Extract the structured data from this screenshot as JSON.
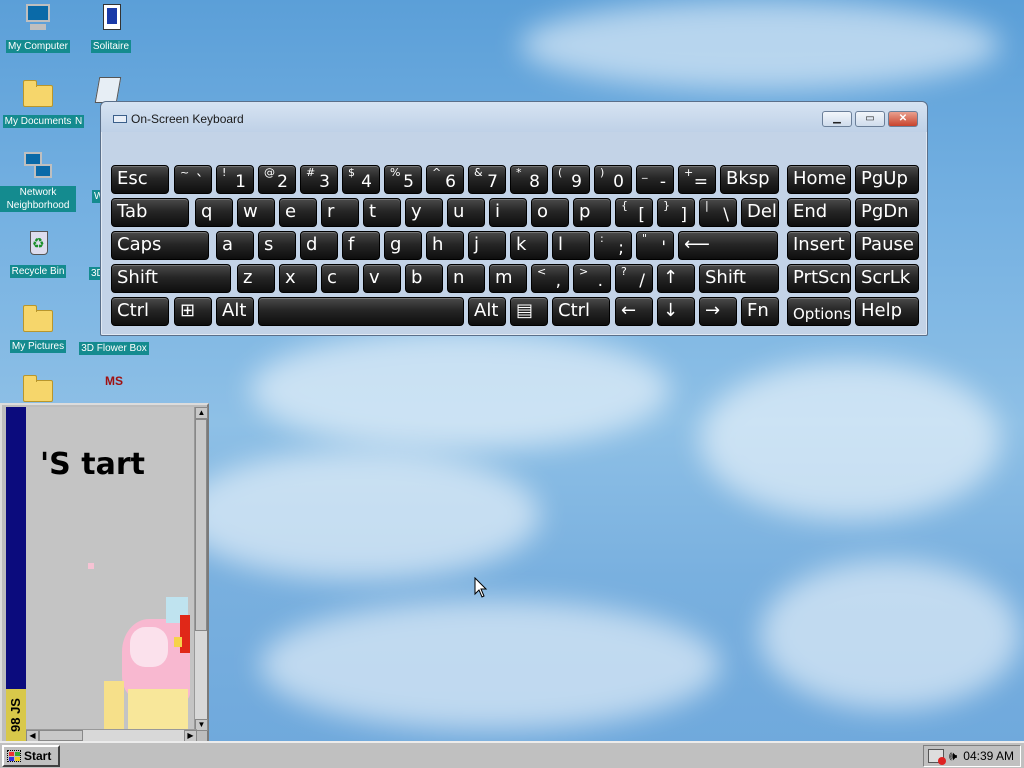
{
  "desktop": {
    "icons": [
      {
        "label": "My Computer"
      },
      {
        "label": "Solitaire"
      },
      {
        "label": "My Documents"
      },
      {
        "label": "N"
      },
      {
        "label": "Network Neighborhood"
      },
      {
        "label": "W"
      },
      {
        "label": "Recycle Bin"
      },
      {
        "label": "3D"
      },
      {
        "label": "My Pictures"
      },
      {
        "label": "3D Flower Box"
      }
    ],
    "extra_icon_text": "MS"
  },
  "osk": {
    "title": "On-Screen Keyboard",
    "controls": {
      "minimize": "▁",
      "restore": "▭",
      "close": "✕"
    },
    "rows": [
      [
        {
          "main": "Esc"
        },
        {
          "shift": "~",
          "base": "`"
        },
        {
          "shift": "!",
          "base": "1"
        },
        {
          "shift": "@",
          "base": "2"
        },
        {
          "shift": "#",
          "base": "3"
        },
        {
          "shift": "$",
          "base": "4"
        },
        {
          "shift": "%",
          "base": "5"
        },
        {
          "shift": "^",
          "base": "6"
        },
        {
          "shift": "&",
          "base": "7"
        },
        {
          "shift": "*",
          "base": "8"
        },
        {
          "shift": "(",
          "base": "9"
        },
        {
          "shift": ")",
          "base": "0"
        },
        {
          "shift": "_",
          "base": "-"
        },
        {
          "shift": "+",
          "base": "="
        },
        {
          "main": "Bksp"
        },
        {
          "main": "Home"
        },
        {
          "main": "PgUp"
        }
      ],
      [
        {
          "main": "Tab"
        },
        {
          "main": "q"
        },
        {
          "main": "w"
        },
        {
          "main": "e"
        },
        {
          "main": "r"
        },
        {
          "main": "t"
        },
        {
          "main": "y"
        },
        {
          "main": "u"
        },
        {
          "main": "i"
        },
        {
          "main": "o"
        },
        {
          "main": "p"
        },
        {
          "shift": "{",
          "base": "["
        },
        {
          "shift": "}",
          "base": "]"
        },
        {
          "shift": "|",
          "base": "\\"
        },
        {
          "main": "Del"
        },
        {
          "main": "End"
        },
        {
          "main": "PgDn"
        }
      ],
      [
        {
          "main": "Caps"
        },
        {
          "main": "a"
        },
        {
          "main": "s"
        },
        {
          "main": "d"
        },
        {
          "main": "f"
        },
        {
          "main": "g"
        },
        {
          "main": "h"
        },
        {
          "main": "j"
        },
        {
          "main": "k"
        },
        {
          "main": "l"
        },
        {
          "shift": ":",
          "base": ";"
        },
        {
          "shift": "\"",
          "base": "'"
        },
        {
          "main": "⟵"
        },
        {
          "main": "Insert"
        },
        {
          "main": "Pause"
        }
      ],
      [
        {
          "main": "Shift"
        },
        {
          "main": "z"
        },
        {
          "main": "x"
        },
        {
          "main": "c"
        },
        {
          "main": "v"
        },
        {
          "main": "b"
        },
        {
          "main": "n"
        },
        {
          "main": "m"
        },
        {
          "shift": "<",
          "base": ","
        },
        {
          "shift": ">",
          "base": "."
        },
        {
          "shift": "?",
          "base": "/"
        },
        {
          "main": "↑"
        },
        {
          "main": "Shift"
        },
        {
          "main": "PrtScn"
        },
        {
          "main": "ScrLk"
        }
      ],
      [
        {
          "main": "Ctrl"
        },
        {
          "main": "⊞"
        },
        {
          "main": "Alt"
        },
        {
          "main": ""
        },
        {
          "main": "Alt"
        },
        {
          "main": "▤"
        },
        {
          "main": "Ctrl"
        },
        {
          "main": "←"
        },
        {
          "main": "↓"
        },
        {
          "main": "→"
        },
        {
          "main": "Fn"
        },
        {
          "main": "Options"
        },
        {
          "main": "Help"
        }
      ]
    ]
  },
  "game": {
    "title_text": "'S tart",
    "version_label": "98 JS"
  },
  "taskbar": {
    "start_label": "Start",
    "clock": "04:39 AM"
  }
}
